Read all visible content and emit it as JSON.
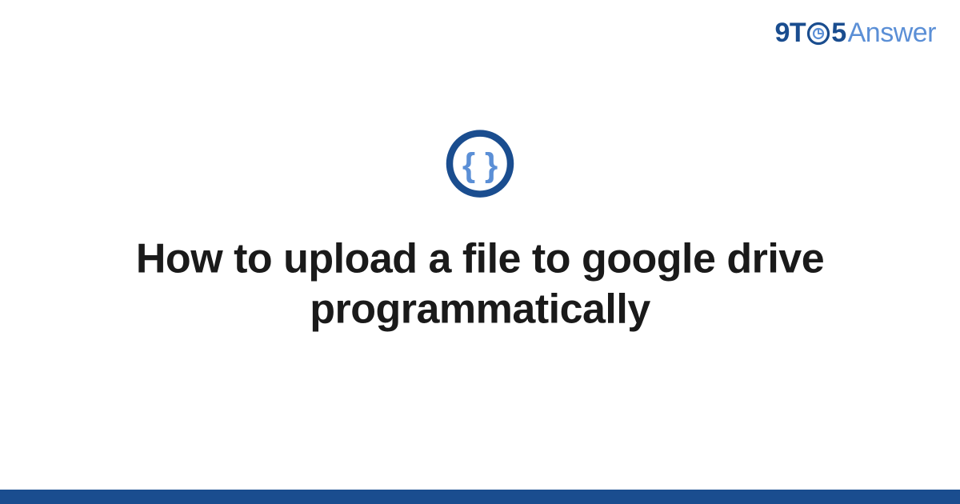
{
  "logo": {
    "part1": "9T",
    "part2": "5",
    "part3": "Answer"
  },
  "icon": {
    "name": "braces-icon"
  },
  "title": "How to upload a file to google drive programmatically",
  "colors": {
    "brand_dark": "#1a4d8f",
    "brand_light": "#5b8fd6",
    "text": "#1a1a1a"
  }
}
